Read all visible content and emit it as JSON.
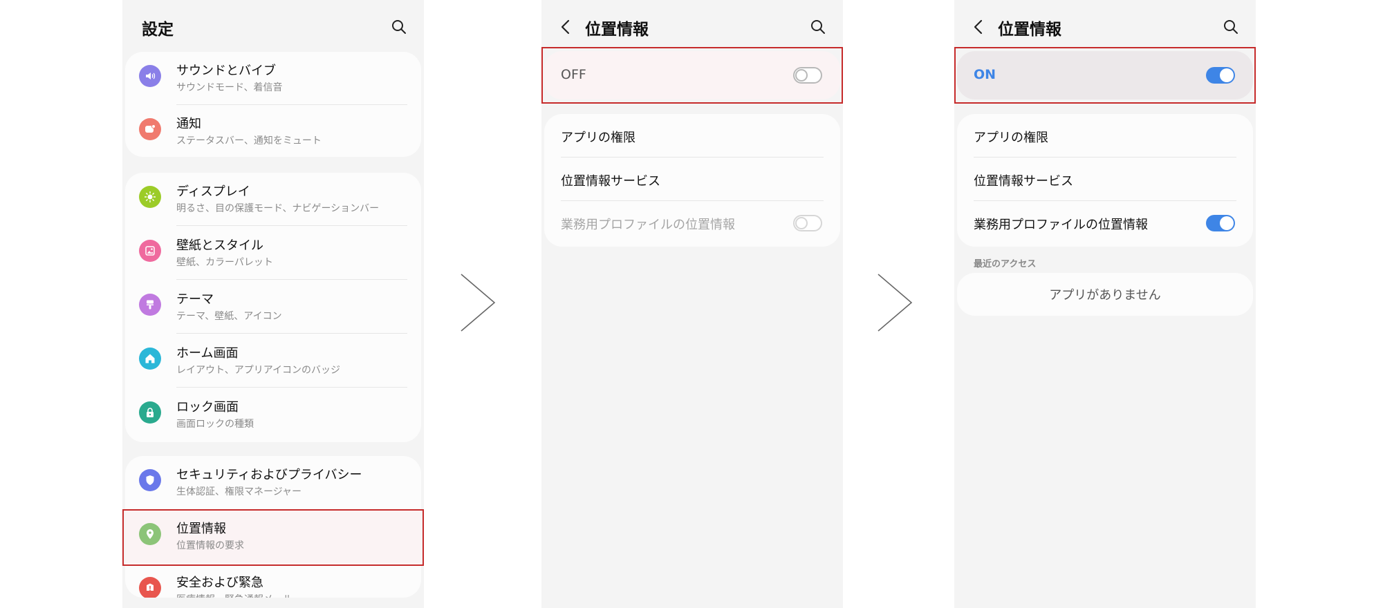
{
  "colors": {
    "panel_background": "#f4f4f4",
    "card_background": "#fcfcfc",
    "highlight_border": "#c62a2a",
    "toggle_on": "#3e85e6",
    "on_text": "#3e85e6"
  },
  "settings": {
    "title": "設定",
    "items": [
      {
        "label": "サウンドとバイブ",
        "sub": "サウンドモード、着信音",
        "icon": "speaker-icon",
        "color": "#8a7fe8"
      },
      {
        "label": "通知",
        "sub": "ステータスバー、通知をミュート",
        "icon": "notification-icon",
        "color": "#f07a6e"
      },
      {
        "label": "ディスプレイ",
        "sub": "明るさ、目の保護モード、ナビゲーションバー",
        "icon": "sun-icon",
        "color": "#9ccc28"
      },
      {
        "label": "壁紙とスタイル",
        "sub": "壁紙、カラーパレット",
        "icon": "image-icon",
        "color": "#ef6a9e"
      },
      {
        "label": "テーマ",
        "sub": "テーマ、壁紙、アイコン",
        "icon": "brush-icon",
        "color": "#c07ae0"
      },
      {
        "label": "ホーム画面",
        "sub": "レイアウト、アプリアイコンのバッジ",
        "icon": "home-icon",
        "color": "#2bb7d8"
      },
      {
        "label": "ロック画面",
        "sub": "画面ロックの種類",
        "icon": "lock-icon",
        "color": "#2aaa8e"
      },
      {
        "label": "セキュリティおよびプライバシー",
        "sub": "生体認証、権限マネージャー",
        "icon": "shield-icon",
        "color": "#6a78ea"
      },
      {
        "label": "位置情報",
        "sub": "位置情報の要求",
        "icon": "location-pin-icon",
        "color": "#8cc478"
      },
      {
        "label": "安全および緊急",
        "sub": "医療情報、緊急通報メール",
        "icon": "alert-icon",
        "color": "#e8564e"
      }
    ]
  },
  "location_off": {
    "title": "位置情報",
    "master_label": "OFF",
    "master_on": false,
    "rows": [
      {
        "label": "アプリの権限"
      },
      {
        "label": "位置情報サービス"
      },
      {
        "label": "業務用プロファイルの位置情報",
        "toggle": "off",
        "disabled": true
      }
    ]
  },
  "location_on": {
    "title": "位置情報",
    "master_label": "ON",
    "master_on": true,
    "rows": [
      {
        "label": "アプリの権限"
      },
      {
        "label": "位置情報サービス"
      },
      {
        "label": "業務用プロファイルの位置情報",
        "toggle": "on"
      }
    ],
    "recent_access_label": "最近のアクセス",
    "no_apps_label": "アプリがありません"
  }
}
